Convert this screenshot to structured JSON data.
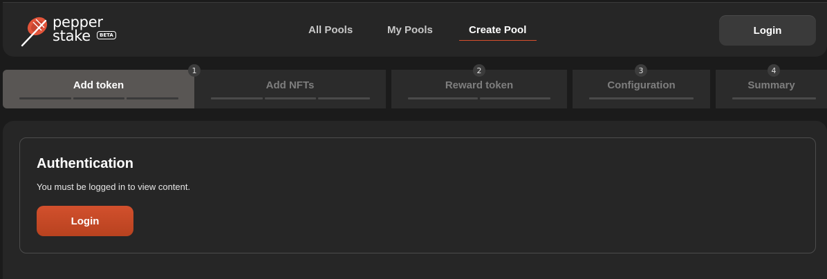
{
  "header": {
    "logo": {
      "word1": "pepper",
      "word2": "stake",
      "beta": "BETA"
    },
    "nav": [
      {
        "label": "All Pools"
      },
      {
        "label": "My Pools"
      },
      {
        "label": "Create Pool",
        "active": true
      }
    ],
    "login_label": "Login"
  },
  "steps": [
    {
      "label": "Add token",
      "badge": "1",
      "active": true
    },
    {
      "label": "Add NFTs",
      "badge": ""
    },
    {
      "label": "Reward token",
      "badge": "2"
    },
    {
      "label": "Configuration",
      "badge": "3"
    },
    {
      "label": "Summary",
      "badge": "4"
    }
  ],
  "auth": {
    "title": "Authentication",
    "message": "You must be logged in to view content.",
    "login_label": "Login"
  },
  "colors": {
    "accent": "#d2502d",
    "background": "#1b1b1b",
    "panel": "#262626"
  }
}
